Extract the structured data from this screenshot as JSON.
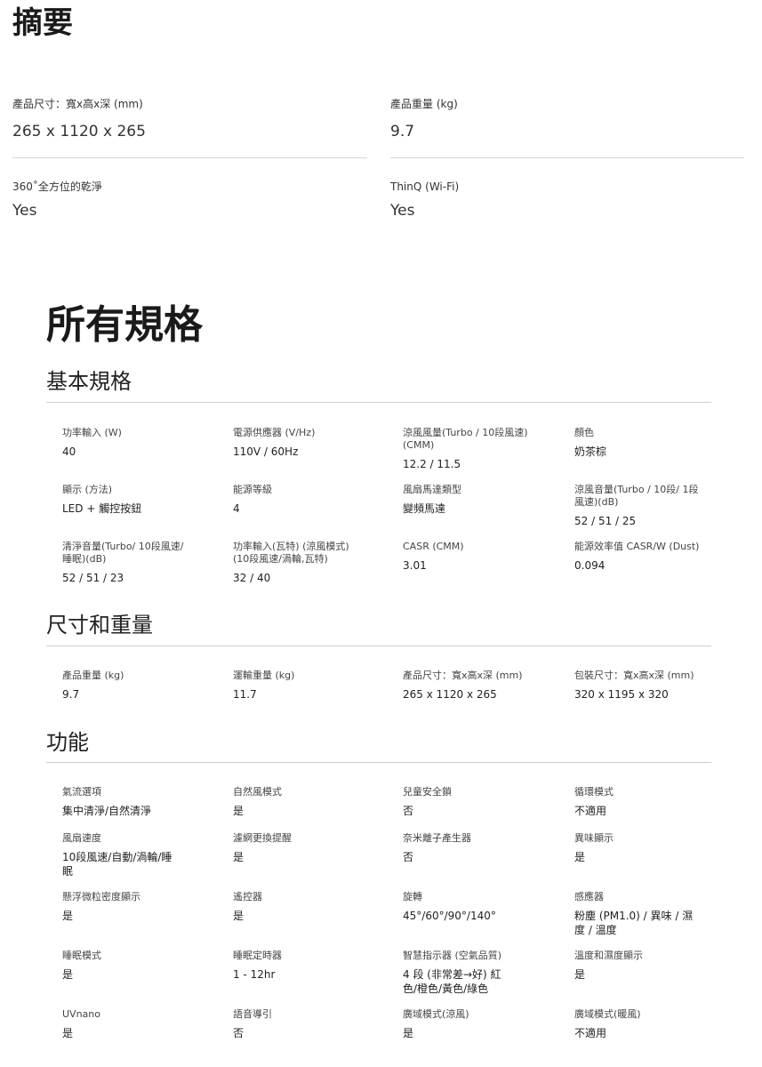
{
  "summary": {
    "title": "摘要",
    "items": [
      {
        "label": "產品尺寸：寬x高x深 (mm)",
        "value": "265 x 1120 x 265"
      },
      {
        "label": "產品重量 (kg)",
        "value": "9.7"
      },
      {
        "label": "360˚全方位的乾淨",
        "value": "Yes"
      },
      {
        "label": "ThinQ (Wi-Fi)",
        "value": "Yes"
      }
    ]
  },
  "all_specs": {
    "title": "所有規格",
    "sections": [
      {
        "title": "基本規格",
        "items": [
          {
            "label": "功率輸入 (W)",
            "value": "40"
          },
          {
            "label": "電源供應器 (V/Hz)",
            "value": "110V / 60Hz"
          },
          {
            "label": "涼風風量(Turbo / 10段風速)\n(CMM)",
            "value": "12.2 / 11.5"
          },
          {
            "label": "顏色",
            "value": "奶茶棕"
          },
          {
            "label": "顯示 (方法)",
            "value": "LED + 觸控按鈕"
          },
          {
            "label": "能源等級",
            "value": "4"
          },
          {
            "label": "風扇馬達類型",
            "value": "變頻馬達"
          },
          {
            "label": "涼風音量(Turbo / 10段/ 1段\n風速)(dB)",
            "value": "52 / 51 / 25"
          },
          {
            "label": "清淨音量(Turbo/ 10段風速/\n睡眠)(dB)",
            "value": "52 / 51 / 23"
          },
          {
            "label": "功率輸入(瓦特) (涼風模式)\n(10段風速/渦輪,瓦特)",
            "value": "32 / 40"
          },
          {
            "label": "CASR (CMM)",
            "value": "3.01"
          },
          {
            "label": "能源效率值 CASR/W (Dust)",
            "value": "0.094"
          }
        ]
      },
      {
        "title": "尺寸和重量",
        "items": [
          {
            "label": "產品重量 (kg)",
            "value": "9.7"
          },
          {
            "label": "運輸重量 (kg)",
            "value": "11.7"
          },
          {
            "label": "產品尺寸：寬x高x深 (mm)",
            "value": "265 x 1120 x 265"
          },
          {
            "label": "包裝尺寸：寬x高x深 (mm)",
            "value": "320 x 1195 x 320"
          }
        ]
      },
      {
        "title": "功能",
        "items": [
          {
            "label": "氣流選項",
            "value": "集中清淨/自然清淨"
          },
          {
            "label": "自然風模式",
            "value": "是"
          },
          {
            "label": "兒童安全鎖",
            "value": "否"
          },
          {
            "label": "循環模式",
            "value": "不適用"
          },
          {
            "label": "風扇速度",
            "value": "10段風速/自動/渦輪/睡\n眠"
          },
          {
            "label": "濾網更換提醒",
            "value": "是"
          },
          {
            "label": "奈米離子產生器",
            "value": "否"
          },
          {
            "label": "異味顯示",
            "value": "是"
          },
          {
            "label": "懸浮微粒密度顯示",
            "value": "是"
          },
          {
            "label": "遙控器",
            "value": "是"
          },
          {
            "label": "旋轉",
            "value": "45°/60°/90°/140°"
          },
          {
            "label": "感應器",
            "value": "粉塵 (PM1.0) / 異味 / 濕\n度 / 溫度"
          },
          {
            "label": "睡眠模式",
            "value": "是"
          },
          {
            "label": "睡眠定時器",
            "value": "1 - 12hr"
          },
          {
            "label": "智慧指示器 (空氣品質)",
            "value": "4 段 (非常差→好) 紅\n色/橙色/黃色/綠色"
          },
          {
            "label": "溫度和濕度顯示",
            "value": "是"
          },
          {
            "label": "UVnano",
            "value": "是"
          },
          {
            "label": "語音導引",
            "value": "否"
          },
          {
            "label": "廣域模式(涼風)",
            "value": "是"
          },
          {
            "label": "廣域模式(暖風)",
            "value": "不適用"
          }
        ]
      }
    ]
  }
}
